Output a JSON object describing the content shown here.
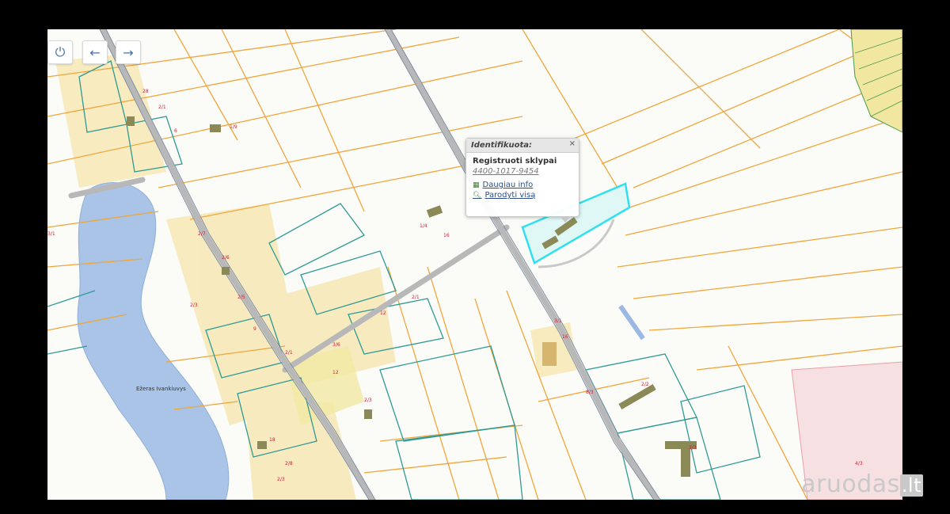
{
  "controls": {
    "power_icon": "power-icon",
    "back_icon": "arrow-left-icon",
    "forward_icon": "arrow-right-icon"
  },
  "popup": {
    "header": "Identifikuota:",
    "close": "×",
    "title": "Registruoti sklypai",
    "parcel_link": "4400-1017-9454",
    "more_info": "Daugiau info",
    "show_all": "Parodyti visą"
  },
  "lake_label": "Ežeras Ivankiuvys",
  "watermark": {
    "text": "aruodas",
    "suffix": ".lt"
  },
  "colors": {
    "parcel_orange": "#f0a63c",
    "parcel_teal": "#2e9a95",
    "lake": "#a9c4e6",
    "road": "#b8b8b8",
    "highlight": "#2fe0ee"
  }
}
